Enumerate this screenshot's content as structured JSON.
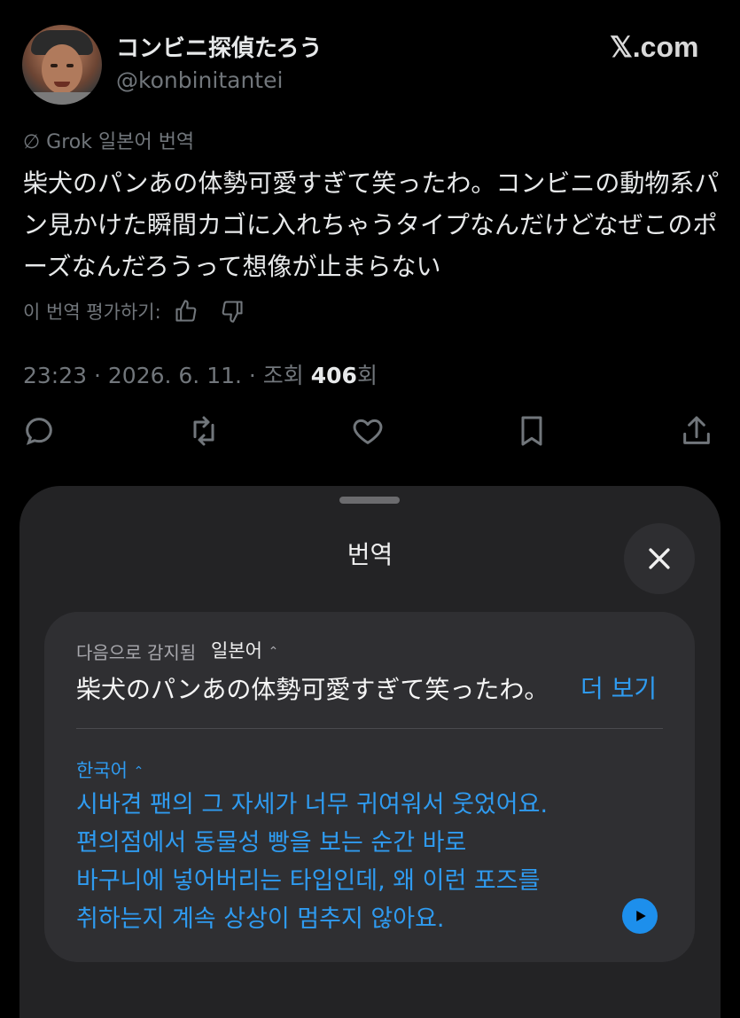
{
  "author": {
    "name": "コンビニ探偵たろう",
    "handle": "@konbinitantei"
  },
  "site": "𝕏.com",
  "translation_label": "Grok 일본어 번역",
  "tweet_text": "柴犬のパンあの体勢可愛すぎて笑ったわ。コンビニの動物系パン見かけた瞬間カゴに入れちゃうタイプなんだけどなぜこのポーズなんだろうって想像が止まらない",
  "rate_label": "이 번역 평가하기:",
  "meta": {
    "time_date": "23:23 · 2026. 6. 11. · 조회 ",
    "views": "406",
    "views_suffix": "회"
  },
  "actions": [
    "reply-icon",
    "retweet-icon",
    "like-icon",
    "bookmark-icon",
    "share-icon"
  ],
  "sheet": {
    "title": "번역",
    "detected_label": "다음으로 감지됨",
    "detected_lang": "일본어",
    "source_text": "柴犬のパンあの体勢可愛すぎて笑ったわ。",
    "more_label": "더 보기",
    "target_lang": "한국어",
    "target_lines": [
      "시바견 팬의 그 자세가 너무 귀여워서 웃었어요.",
      "편의점에서 동물성 빵을 보는 순간 바로",
      "바구니에 넣어버리는 타입인데, 왜 이런 포즈를",
      "취하는지 계속 상상이 멈추지 않아요."
    ]
  },
  "colors": {
    "background": "#000000",
    "accent": "#2f9bf0",
    "sheet": "#232325",
    "card": "#2f2f32"
  }
}
